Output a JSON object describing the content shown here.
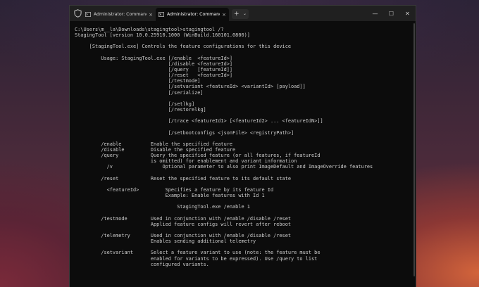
{
  "window": {
    "tabs": [
      {
        "title": "Administrator: Command Prom",
        "close": "×",
        "active": false
      },
      {
        "title": "Administrator: Command Pro",
        "close": "×",
        "active": true
      }
    ],
    "new_tab": "+",
    "tab_dropdown": "⌄",
    "controls": {
      "minimize": "—",
      "maximize": "☐",
      "close": "✕"
    }
  },
  "terminal": {
    "lines": [
      "C:\\Users\\m__la\\Downloads\\stagingtool>stagingtool /?",
      "StagingTool [version 10.0.25910.1000 (WinBuild.160101.0800)]",
      "",
      "     [StagingTool.exe] Controls the feature configurations for this device",
      "",
      "         Usage: StagingTool.exe [/enable  <featureId>]",
      "                                [/disable <featureId>]",
      "                                [/query   [featureId]]",
      "                                [/reset   <featureId>]",
      "                                [/testmode]",
      "                                [/setvariant <featureId> <variantId> [payload]]",
      "                                [/serialize]",
      "",
      "                                [/setlkg]",
      "                                [/restorelkg]",
      "",
      "                                [/trace <featureId1> [<featureId2> ... <featureIdN>]]",
      "",
      "                                [/setbootconfigs <jsonFile> <registryPath>]",
      "",
      "         /enable          Enable the specified feature",
      "         /disable         Disable the specified feature",
      "         /query           Query the specified feature (or all features, if featureId",
      "                          is omitted) for enablement and variant information",
      "           /v                 Optional parameter to also print ImageDefault and ImageOverride features",
      "",
      "         /reset           Reset the specified feature to its default state",
      "",
      "           <featureId>         Specifies a feature by its feature Id",
      "                               Example: Enable features with Id 1",
      "",
      "                                   StagingTool.exe /enable 1",
      "",
      "         /testmode        Used in conjunction with /enable /disable /reset",
      "                          Applied feature configs will revert after reboot",
      "",
      "         /telemetry       Used in conjunction with /enable /disable /reset",
      "                          Enables sending additional telemetry",
      "",
      "         /setvariant      Select a feature variant to use (note: the feature must be",
      "                          enabled for variants to be expressed). Use /query to list",
      "                          configured variants."
    ]
  }
}
